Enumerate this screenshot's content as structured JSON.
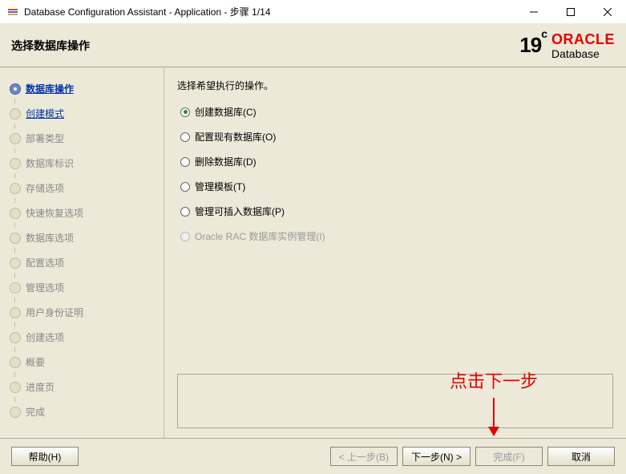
{
  "window": {
    "title": "Database Configuration Assistant - Application - 步骤 1/14"
  },
  "header": {
    "page_title": "选择数据库操作",
    "logo_version": "19",
    "logo_version_sup": "c",
    "logo_brand": "ORACLE",
    "logo_product": "Database"
  },
  "sidebar": {
    "steps": [
      {
        "label": "数据库操作",
        "state": "current"
      },
      {
        "label": "创建模式",
        "state": "next"
      },
      {
        "label": "部署类型",
        "state": "future"
      },
      {
        "label": "数据库标识",
        "state": "future"
      },
      {
        "label": "存储选项",
        "state": "future"
      },
      {
        "label": "快速恢复选项",
        "state": "future"
      },
      {
        "label": "数据库选项",
        "state": "future"
      },
      {
        "label": "配置选项",
        "state": "future"
      },
      {
        "label": "管理选项",
        "state": "future"
      },
      {
        "label": "用户身份证明",
        "state": "future"
      },
      {
        "label": "创建选项",
        "state": "future"
      },
      {
        "label": "概要",
        "state": "future"
      },
      {
        "label": "进度页",
        "state": "future"
      },
      {
        "label": "完成",
        "state": "future"
      }
    ]
  },
  "main": {
    "instruction": "选择希望执行的操作。",
    "options": [
      {
        "label": "创建数据库(C)",
        "selected": true,
        "enabled": true
      },
      {
        "label": "配置现有数据库(O)",
        "selected": false,
        "enabled": true
      },
      {
        "label": "删除数据库(D)",
        "selected": false,
        "enabled": true
      },
      {
        "label": "管理模板(T)",
        "selected": false,
        "enabled": true
      },
      {
        "label": "管理可插入数据库(P)",
        "selected": false,
        "enabled": true
      },
      {
        "label": "Oracle RAC 数据库实例管理(I)",
        "selected": false,
        "enabled": false
      }
    ]
  },
  "annotation": {
    "text": "点击下一步"
  },
  "footer": {
    "help": "帮助(H)",
    "back": "< 上一步(B)",
    "next": "下一步(N) >",
    "finish": "完成(F)",
    "cancel": "取消"
  }
}
